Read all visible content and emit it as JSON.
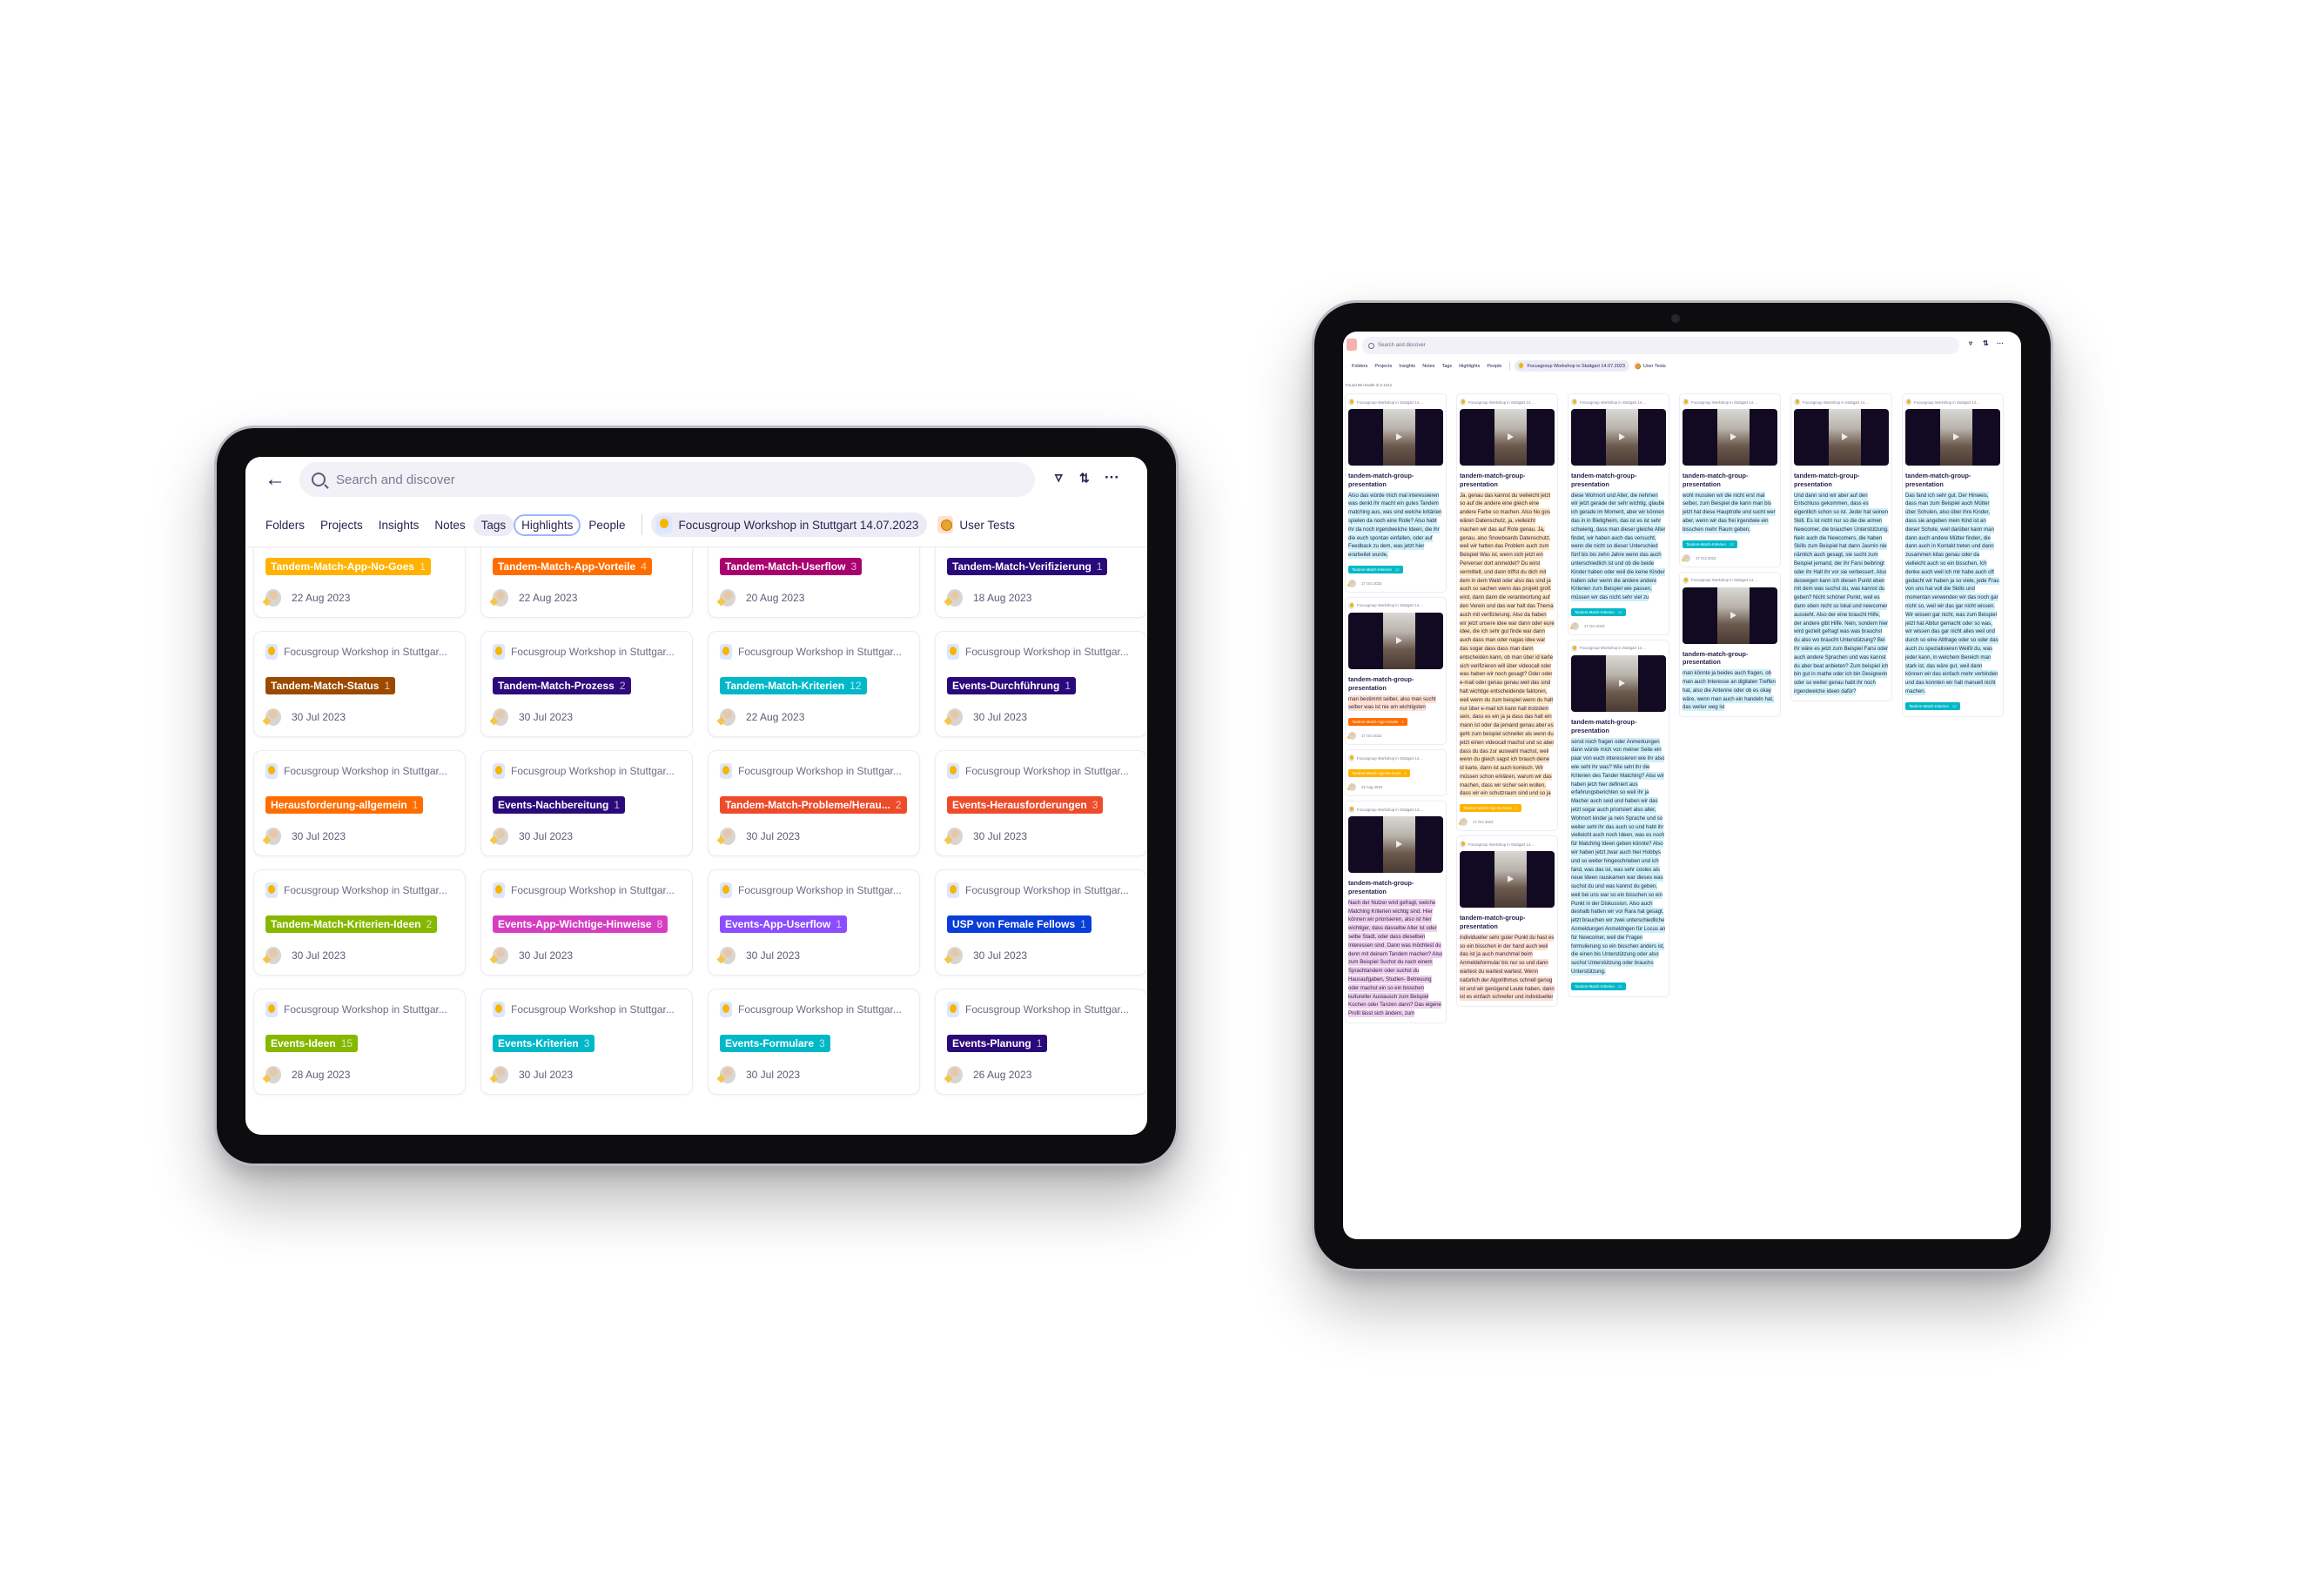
{
  "left_tablet": {
    "search": {
      "placeholder": "Search and discover"
    },
    "header_icons": [
      "back-arrow-icon",
      "filter-icon",
      "sort-icon",
      "more-icon"
    ],
    "tabs": [
      {
        "label": "Folders"
      },
      {
        "label": "Projects"
      },
      {
        "label": "Insights"
      },
      {
        "label": "Notes"
      },
      {
        "label": "Tags",
        "state": "selected"
      },
      {
        "label": "Highlights",
        "state": "focused"
      },
      {
        "label": "People"
      }
    ],
    "project_chip": "Focusgroup Workshop in Stuttgart 14.07.2023",
    "user_tests": "User Tests",
    "cards": [
      {
        "source": "",
        "tag": "Tandem-Match-App-No-Goes",
        "count": "1",
        "color": "#ffb300",
        "date": "22 Aug 2023"
      },
      {
        "source": "",
        "tag": "Tandem-Match-App-Vorteile",
        "count": "4",
        "color": "#ff6d00",
        "date": "22 Aug 2023"
      },
      {
        "source": "",
        "tag": "Tandem-Match-Userflow",
        "count": "3",
        "color": "#a8006e",
        "date": "20 Aug 2023"
      },
      {
        "source": "",
        "tag": "Tandem-Match-Verifizierung",
        "count": "1",
        "color": "#2a0a7a",
        "date": "18 Aug 2023"
      },
      {
        "source": "Focusgroup Workshop in Stuttgar...",
        "tag": "Tandem-Match-Status",
        "count": "1",
        "color": "#9c4a00",
        "date": "30 Jul 2023"
      },
      {
        "source": "Focusgroup Workshop in Stuttgar...",
        "tag": "Tandem-Match-Prozess",
        "count": "2",
        "color": "#2e0a7a",
        "date": "30 Jul 2023"
      },
      {
        "source": "Focusgroup Workshop in Stuttgar...",
        "tag": "Tandem-Match-Kriterien",
        "count": "12",
        "color": "#00b8c8",
        "date": "22 Aug 2023"
      },
      {
        "source": "Focusgroup Workshop in Stuttgar...",
        "tag": "Events-Durchführung",
        "count": "1",
        "color": "#2a0a7a",
        "date": "30 Jul 2023"
      },
      {
        "source": "Focusgroup Workshop in Stuttgar...",
        "tag": "Herausforderung-allgemein",
        "count": "1",
        "color": "#ff6d00",
        "date": "30 Jul 2023"
      },
      {
        "source": "Focusgroup Workshop in Stuttgar...",
        "tag": "Events-Nachbereitung",
        "count": "1",
        "color": "#2a0a7a",
        "date": "30 Jul 2023"
      },
      {
        "source": "Focusgroup Workshop in Stuttgar...",
        "tag": "Tandem-Match-Probleme/Herau...",
        "count": "2",
        "color": "#ee4b2b",
        "date": "30 Jul 2023"
      },
      {
        "source": "Focusgroup Workshop in Stuttgar...",
        "tag": "Events-Herausforderungen",
        "count": "3",
        "color": "#ee4b2b",
        "date": "30 Jul 2023"
      },
      {
        "source": "Focusgroup Workshop in Stuttgar...",
        "tag": "Tandem-Match-Kriterien-Ideen",
        "count": "2",
        "color": "#86b800",
        "date": "30 Jul 2023"
      },
      {
        "source": "Focusgroup Workshop in Stuttgar...",
        "tag": "Events-App-Wichtige-Hinweise",
        "count": "8",
        "color": "#d63ec2",
        "date": "30 Jul 2023"
      },
      {
        "source": "Focusgroup Workshop in Stuttgar...",
        "tag": "Events-App-Userflow",
        "count": "1",
        "color": "#8b4dff",
        "date": "30 Jul 2023"
      },
      {
        "source": "Focusgroup Workshop in Stuttgar...",
        "tag": "USP von Female Fellows",
        "count": "1",
        "color": "#0a3ed8",
        "date": "30 Jul 2023"
      },
      {
        "source": "Focusgroup Workshop in Stuttgar...",
        "tag": "Events-Ideen",
        "count": "15",
        "color": "#86b800",
        "date": "28 Aug 2023"
      },
      {
        "source": "Focusgroup Workshop in Stuttgar...",
        "tag": "Events-Kriterien",
        "count": "3",
        "color": "#00b8c8",
        "date": "30 Jul 2023"
      },
      {
        "source": "Focusgroup Workshop in Stuttgar...",
        "tag": "Events-Formulare",
        "count": "3",
        "color": "#00b8c8",
        "date": "30 Jul 2023"
      },
      {
        "source": "Focusgroup Workshop in Stuttgar...",
        "tag": "Events-Planung",
        "count": "1",
        "color": "#2a0a7a",
        "date": "26 Aug 2023"
      }
    ]
  },
  "right_tablet": {
    "search": {
      "placeholder": "Search and discover"
    },
    "tabs": [
      {
        "label": "Folders"
      },
      {
        "label": "Projects"
      },
      {
        "label": "Insights"
      },
      {
        "label": "Notes"
      },
      {
        "label": "Tags"
      },
      {
        "label": "Highlights"
      },
      {
        "label": "People"
      }
    ],
    "project_chip": "Focusgroup Workshop in Stuttgart 14.07.2023",
    "user_tests": "User Tests",
    "results_text": "Found 88 results in 0.121s",
    "highlight_colors": {
      "cyan": "#cdf1f6",
      "orange": "#ffe7c2",
      "peach": "#ffe1cf",
      "pink": "#f1d2ec"
    },
    "columns": [
      [
        {
          "source": "Focusgroup Workshop in Stuttgart 14....",
          "video": true,
          "title": "tandem-match-group-presentation",
          "text": "Also das würde mich mal interessieren was denkt ihr macht ein gutes Tandem matching aus, was sind welche kritärien spielen da noch eine Rolle? Also habt ihr da noch irgendwelche Ideen, die ihr die euch spontan einfallen, oder auf Feedback zu dem, was jetzt hier erarbeitet wurde,",
          "hl": "cyan",
          "tag": "Tandem-Match-Kriterien",
          "count": "12",
          "color": "#00b8c8",
          "date": "17 Oct 2023"
        },
        {
          "source": "Focusgroup Workshop in Stuttgart 14....",
          "video": true,
          "title": "tandem-match-group-presentation",
          "text": "man bestimmt selber, also man sucht selber was ist nie am wichtigsten",
          "hl": "peach",
          "tag": "Tandem-Match-App-Vorteile",
          "count": "4",
          "color": "#ff6d00",
          "date": "17 Oct 2023"
        },
        {
          "source": "Focusgroup Workshop in Stuttgart 14....",
          "video": false,
          "title": "",
          "text": "",
          "hl": "",
          "tag": "Tandem-Match-App-No-Goes",
          "count": "1",
          "color": "#ffb300",
          "date": "22 Aug 2023"
        },
        {
          "source": "Focusgroup Workshop in Stuttgart 14....",
          "video": true,
          "title": "tandem-match-group-presentation",
          "text": "Nach der Nutzer wird gefragt, welche Matching Kriterien wichtig sind. Hier können wir priorisieren, also ist hier wichtiger, dass dasselbe Alter ist oder selbe Stadt, oder dass dieselben Interessen sind. Dann was möchtest du denn mit deinem Tandem machen? Also zum Beispiel Suchst du nach einem Sprachtandem oder suchst du Hausaufgaben, Studien- Betreuung oder machst ein so ein bisschen kultureller Austausch zum Beispiel Kochen oder Tanzen dann? Das eigene Profil lässt sich ändern, zum",
          "hl": "pink",
          "tag": "",
          "count": "",
          "color": "",
          "date": ""
        }
      ],
      [
        {
          "source": "Focusgroup Workshop in Stuttgart 14....",
          "video": true,
          "title": "tandem-match-group-presentation",
          "text": "Ja, genau das kannst du vielleicht jetzt so auf die andere eine gleich eine andere Farbe so machen. Also No gos wären Datenschutz, ja, vielleicht machen wir das auf Rote genau. Ja, genau, also Snowboards Datenschutz, weil wir hatten das Problem auch zum Beispiel Was ist, wenn sich jetzt ein Perverser dort anmeldet? Du wirst vermittelt, und dann triffst du dich mit dem in dem Wald oder also das sind ja auch so sachen wenn das projekt groß wird, dann dann die verantwortung auf den Verein und das war halt das Thema auch mit verifizierung. Also da haben wir jetzt unsere idee war dann oder eure idee, die ich sehr gut finde war dann auch dass man oder nagas idee war das sogar dass dass man dann entscheiden kann, ob man über id karte sich verifizieren will über videocall oder was haben wir noch gesagt? Oder oder e-mail oder genau genau weil das sind halt wichtige entscheidende faktoren, weil wenn du zum beispiel wenn du halt nur über e-mail ich kann halt trotzdem sein, dass es ein ja ja dass das halt ein mann ist oder da jemand genau aber es geht zum beispiel schneller als wenn du jetzt einen videocall machst und so aber dass du das zur auswahl machst, weil wenn du gleich sagst ich brauch deine id karte, dann ist auch komisch. Wir müssen schon erklären, warum wir das machen, dass wir sicher sein wollen, dass wir ein schutzraum sind und so ja",
          "hl": "orange",
          "tag": "Tandem-Match-App-No-Goes",
          "count": "1",
          "color": "#ffb300",
          "date": "17 Oct 2023"
        },
        {
          "source": "Focusgroup Workshop in Stuttgart 14....",
          "video": true,
          "title": "tandem-match-group-presentation",
          "text": "individueller sehr guter Punkt du hast es so ein bisschen in der hand auch weil das ist ja auch manchmal beim Anmeldeformular bis nur so und dann wartest du wartest wartest. Wenn natürlich der Algorithmus schnell genug ist und wir genügend Leute haben, dann ist es einfach schneller und individueller",
          "hl": "peach",
          "tag": "",
          "count": "",
          "color": "",
          "date": ""
        }
      ],
      [
        {
          "source": "Focusgroup Workshop in Stuttgart 14....",
          "video": true,
          "title": "tandem-match-group-presentation",
          "text": "diese Wohnort und Alter, die nehmen wir jetzt gerade der sehr wichtig, glaube ich gerade im Moment, aber wir können das in in Bietigheim, das ist es ist sehr schwierig, dass man dieser gleiche Alter findet, wir haben auch das versucht, wenn die nicht so dieser Unterschied fünf bis bis zehn Jahre wenn das auch unterschiedlich ist und ob die beide Kinder haben oder weil die keine Kinder haben oder wenn die andere andere Kriterien zum Beispiel wie passen, müssen wir das nicht sehr viel zu",
          "hl": "cyan",
          "tag": "Tandem-Match-Kriterien",
          "count": "12",
          "color": "#00b8c8",
          "date": "17 Oct 2023"
        },
        {
          "source": "Focusgroup Workshop in Stuttgart 14....",
          "video": true,
          "title": "tandem-match-group-presentation",
          "text": "sonst noch fragen oder Anmerkungen dann würde mich von meiner Seite ein paar von euch interessieren wie ihr also wie seht ihr was? Wie seht ihr die Kriterien des Tander Matching? Also wir haben jetzt hier definiert aus erfahrungsberichten so weil ihr ja Macher auch seid und haben wir das jetzt sogar auch priorisiert also alter, Wohnort kinder ja nein Sprache und so weiter seht ihr das auch so und habt ihr vielleicht auch noch Ideen, was es noch für Matching Ideen geben könnte? Also wir haben jetzt zwar auch hier Hobbys und so weiter hingeschrieben und ich fand, was das ist, was sehr cooles als neue Ideen rauskamen war dieses was suchst du und was kannst du geben, weil bei uns war so ein bisschen so ein Punkt in der Diskussion. Also auch deshalb hatten wir vor Rara hat gesagt, jetzt brauchen wir zwei unterschiedliche Anmeldungen Anmeldngen für Locus an für Newcomer, weil die Fragen formulierung so ein bisschen anders ist, die einen bis Unterstützung oder also suchst Unterstützung oder brauchs Unterstützung.",
          "hl": "cyan",
          "tag": "Tandem-Match-Kriterien",
          "count": "12",
          "color": "#00b8c8",
          "date": ""
        }
      ],
      [
        {
          "source": "Focusgroup Workshop in Stuttgart 14....",
          "video": true,
          "title": "tandem-match-group-presentation",
          "text": "wohl mussten wir die nicht erst mal selber, zum Beispiel die kann man bis jetzt hat diese Hauptrolle und sucht wer aber, wenn wir das frei irgendwie ein bisschen mehr Raum geben,",
          "hl": "cyan",
          "tag": "Tandem-Match-Kriterien",
          "count": "12",
          "color": "#00b8c8",
          "date": "17 Oct 2023"
        },
        {
          "source": "Focusgroup Workshop in Stuttgart 14....",
          "video": true,
          "title": "tandem-match-group-presentation",
          "text": "man könnte ja beides auch fragen, ob man auch Interesse an digitalen Treffen hat, also die Antenne oder ob es okay wäre, wenn man auch ein handeln hat, das weiter weg ist",
          "hl": "cyan",
          "tag": "",
          "count": "",
          "color": "",
          "date": ""
        }
      ],
      [
        {
          "source": "Focusgroup Workshop in Stuttgart 14....",
          "video": true,
          "title": "tandem-match-group-presentation",
          "text": "Und dann sind wir aber auf den Entschluss gekommen, dass es eigentlich schon so ist. Jeder hat seinen Skill. Es ist nicht nur so die die armen Newcomer, die brauchen Unterstützung. Nein auch die Newcomers, die haben Skills zum Beispiel hat dann Jasmin nie nämlich auch gesagt, sie sucht zum Beispiel jemand, der ihr Farsi beibringt oder ihr Halt ihr vor sie verbessert. Also deswegen kann ich diesen Punkt eben mit dem was suchst du, was kannst du geben? Nicht schöner Punkt, weil es dann eben nicht so lokal und newcomer aussieht. Also der eine braucht Hilfe, der andere gibt Hilfe. Nein, sondern hier wird gezielt gefragt was was brauchst du also wo braucht Unterstützung? Bei ihr wäre es jetzt zum Beispiel Farsi oder auch andere Sprachen und was kannst du aber beat anbieten? Zum beispiel ich bin gut in mathe oder ich bin Designerin oder so weiter genau habt ihr noch irgendwelche ideen dafür?",
          "hl": "cyan",
          "tag": "",
          "count": "",
          "color": "",
          "date": ""
        }
      ],
      [
        {
          "source": "Focusgroup Workshop in Stuttgart 14....",
          "video": true,
          "title": "tandem-match-group-presentation",
          "text": "Das fand ich sehr gut. Der Hinweis, dass man zum Beispiel auch Mütter über Schulen, also über ihre Kinder, dass sie angeben mein Kind ist an dieser Schule, weil darüber kann man dann auch andere Mütter finden, die dann auch in Kontakt treten und dann zusammen kitas genau oder da vielleicht auch so ein bisschen. Ich denke auch weil ich mir habe auch oft gedacht wir haben ja so viele, jede Frau von uns hat voll die Skills und momentan verwenden wir das noch gar nicht so, weil wir das gar nicht wissen. Wir wissen gar nicht, was zum Beispiel jetzt hat Abitur gemacht oder so was, wir wissen das gar nicht alles weil und durch so eine Abfrage oder so oder das auch zu spezialisieren Weißt du, was jeder kann, in welchem Bereich man stark ist, das wäre gut, weil dann können wir das einfach mehr verbinden und das konnten wir halt manuell nicht machen.",
          "hl": "cyan",
          "tag": "Tandem-Match-Kriterien",
          "count": "12",
          "color": "#00b8c8",
          "date": ""
        }
      ]
    ]
  }
}
